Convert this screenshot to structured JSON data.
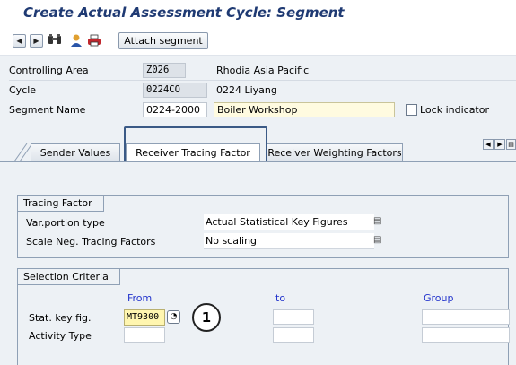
{
  "title": "Create Actual Assessment Cycle: Segment",
  "toolbar": {
    "prev_icon": "◀",
    "next_icon": "▶",
    "find_icon": "binoculars-icon",
    "attach_label": "Attach segment"
  },
  "header": {
    "controlling_area": {
      "label": "Controlling Area",
      "code": "Z026",
      "desc": "Rhodia Asia Pacific"
    },
    "cycle": {
      "label": "Cycle",
      "code": "0224CO",
      "desc": "0224 Liyang"
    },
    "segment": {
      "label": "Segment Name",
      "code": "0224-2000",
      "desc": "Boiler Workshop",
      "lock_label": "Lock indicator"
    }
  },
  "tabs": [
    {
      "label": "Sender Values"
    },
    {
      "label": "Receiver Tracing Factor"
    },
    {
      "label": "Receiver Weighting Factors"
    }
  ],
  "tracing": {
    "title": "Tracing Factor",
    "var_portion": {
      "label": "Var.portion type",
      "value": "Actual Statistical Key Figures"
    },
    "scale_neg": {
      "label": "Scale Neg. Tracing Factors",
      "value": "No scaling"
    }
  },
  "selection": {
    "title": "Selection Criteria",
    "col_from": "From",
    "col_to": "to",
    "col_group": "Group",
    "stat_key": {
      "label": "Stat. key fig.",
      "from": "MT9300"
    },
    "activity": {
      "label": "Activity Type"
    }
  },
  "callout": "1",
  "colors": {
    "title": "#1f3a73",
    "column_header": "#2233cc",
    "active_input": "#fff6b0"
  }
}
